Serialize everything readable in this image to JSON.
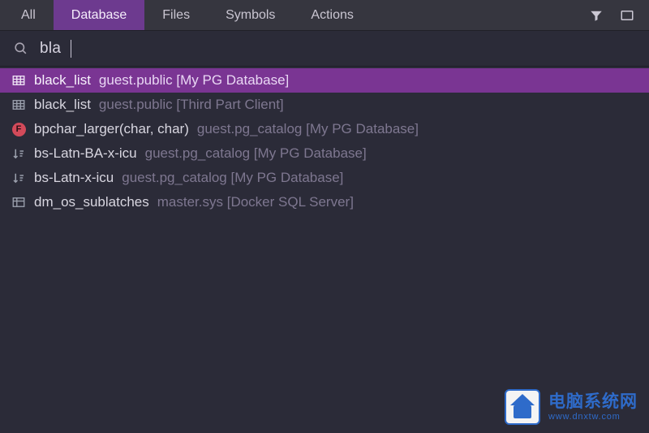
{
  "tabs": {
    "items": [
      {
        "label": "All",
        "active": false
      },
      {
        "label": "Database",
        "active": true
      },
      {
        "label": "Files",
        "active": false
      },
      {
        "label": "Symbols",
        "active": false
      },
      {
        "label": "Actions",
        "active": false
      }
    ]
  },
  "search": {
    "value": "bla",
    "placeholder": ""
  },
  "results": [
    {
      "icon": "table-icon",
      "name": "black_list",
      "meta": "guest.public [My PG Database]",
      "selected": true
    },
    {
      "icon": "table-icon",
      "name": "black_list",
      "meta": "guest.public [Third Part Client]",
      "selected": false
    },
    {
      "icon": "function-icon",
      "name": "bpchar_larger(char, char)",
      "meta": "guest.pg_catalog [My PG Database]",
      "selected": false
    },
    {
      "icon": "collation-icon",
      "name": "bs-Latn-BA-x-icu",
      "meta": "guest.pg_catalog [My PG Database]",
      "selected": false
    },
    {
      "icon": "collation-icon",
      "name": "bs-Latn-x-icu",
      "meta": "guest.pg_catalog [My PG Database]",
      "selected": false
    },
    {
      "icon": "view-icon",
      "name": "dm_os_sublatches",
      "meta": "master.sys [Docker SQL Server]",
      "selected": false
    }
  ],
  "watermark": {
    "title": "电脑系统网",
    "subtitle": "www.dnxtw.com"
  }
}
